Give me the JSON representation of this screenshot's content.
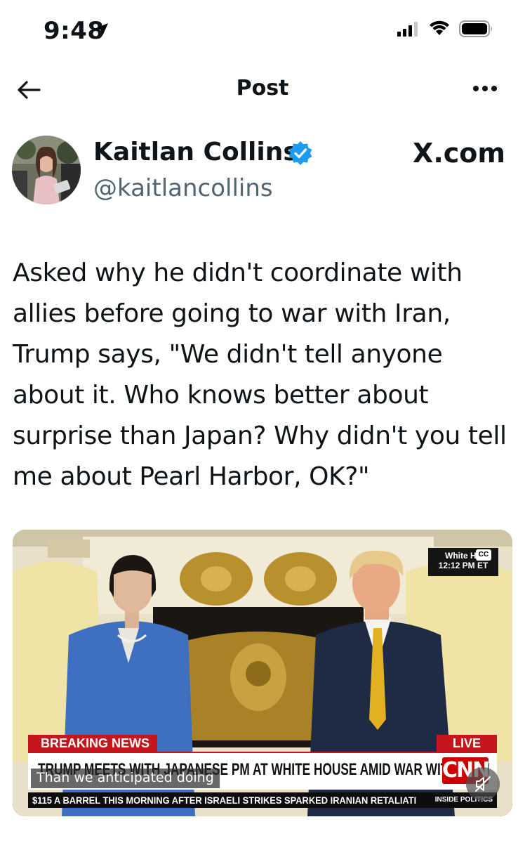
{
  "status_bar": {
    "time": "9:48",
    "icons": [
      "location-arrow-icon",
      "signal-icon",
      "wifi-icon",
      "battery-icon"
    ]
  },
  "nav": {
    "title": "Post",
    "back_icon": "arrow-left-icon",
    "more_icon": "more-horizontal-icon"
  },
  "author": {
    "name": "Kaitlan Collins",
    "handle": "@kaitlancollins",
    "verified": true,
    "verified_color": "#1d9bf0"
  },
  "source_label": "X.com",
  "tweet": {
    "text": "Asked why he didn't coordinate with allies before going to war with Iran, Trump says, \"We didn't tell anyone about it. Who knows better about surprise than Japan? Why didn't you tell me about Pearl Harbor, OK?\""
  },
  "media": {
    "bug_lines": [
      "White Ho",
      "12:12 PM ET"
    ],
    "cc_label": "CC",
    "breaking_label": "BREAKING NEWS",
    "live_label": "LIVE",
    "headline": "TRUMP MEETS WITH JAPANESE PM AT WHITE HOUSE AMID WAR WITH IRAN",
    "network_logo": "CNN",
    "caption": "Than we anticipated doing",
    "ticker": "$115 A BARREL THIS MORNING AFTER ISRAELI STRIKES SPARKED IRANIAN RETALIATI",
    "ticker_tag": "INSIDE POLITICS",
    "mute_icon": "volume-muted-icon",
    "accent_color": "#c4161c"
  }
}
